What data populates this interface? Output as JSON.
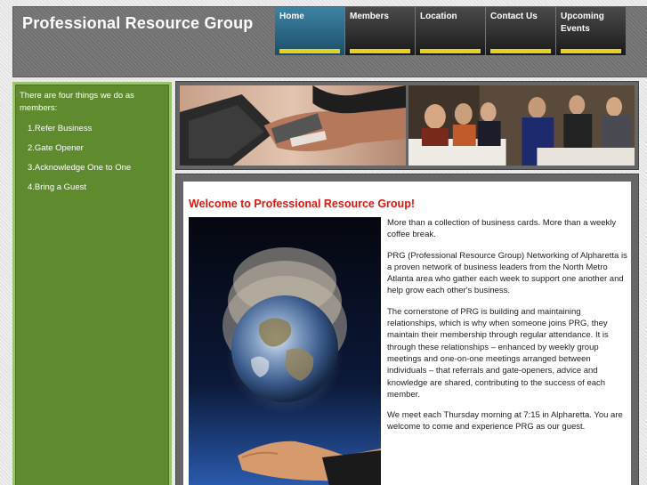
{
  "header": {
    "title": "Professional Resource Group"
  },
  "nav": {
    "items": [
      {
        "label": "Home",
        "active": true
      },
      {
        "label": "Members",
        "active": false
      },
      {
        "label": "Location",
        "active": false
      },
      {
        "label": "Contact Us",
        "active": false
      },
      {
        "label": "Upcoming Events",
        "active": false
      }
    ]
  },
  "sidebar": {
    "intro": "There are four things we do as members:",
    "items": [
      "1.Refer Business",
      "2.Gate Opener",
      "3.Acknowledge One to One",
      "4.Bring a Guest"
    ]
  },
  "banner": {
    "left_photo_icon": "handshake-with-business-card-photo",
    "right_photo_icon": "networking-event-photo"
  },
  "content": {
    "heading": "Welcome to Professional Resource Group!",
    "image_icon": "globe-in-hand-photo",
    "paragraphs": [
      "More than a collection of business cards. More than a weekly coffee break.",
      "PRG (Professional Resource Group) Networking of Alpharetta is a proven network of business leaders from the North Metro Atlanta area who gather each week to support one another and help grow each other's business.",
      "The cornerstone of PRG is building and maintaining relationships, which is why when someone joins PRG, they maintain their membership through regular attendance. It is through these relationships – enhanced by weekly group meetings and one-on-one meetings arranged between individuals – that referrals and gate-openers, advice and knowledge are shared, contributing to the success of each member.",
      "We meet each Thursday morning at 7:15 in Alpharetta. You are welcome to come and experience PRG as our guest."
    ]
  },
  "colors": {
    "title_red": "#d61a10",
    "sidebar_green": "#5f8a2e",
    "nav_active": "#2f6e90",
    "nav_accent": "#e6d21c"
  }
}
